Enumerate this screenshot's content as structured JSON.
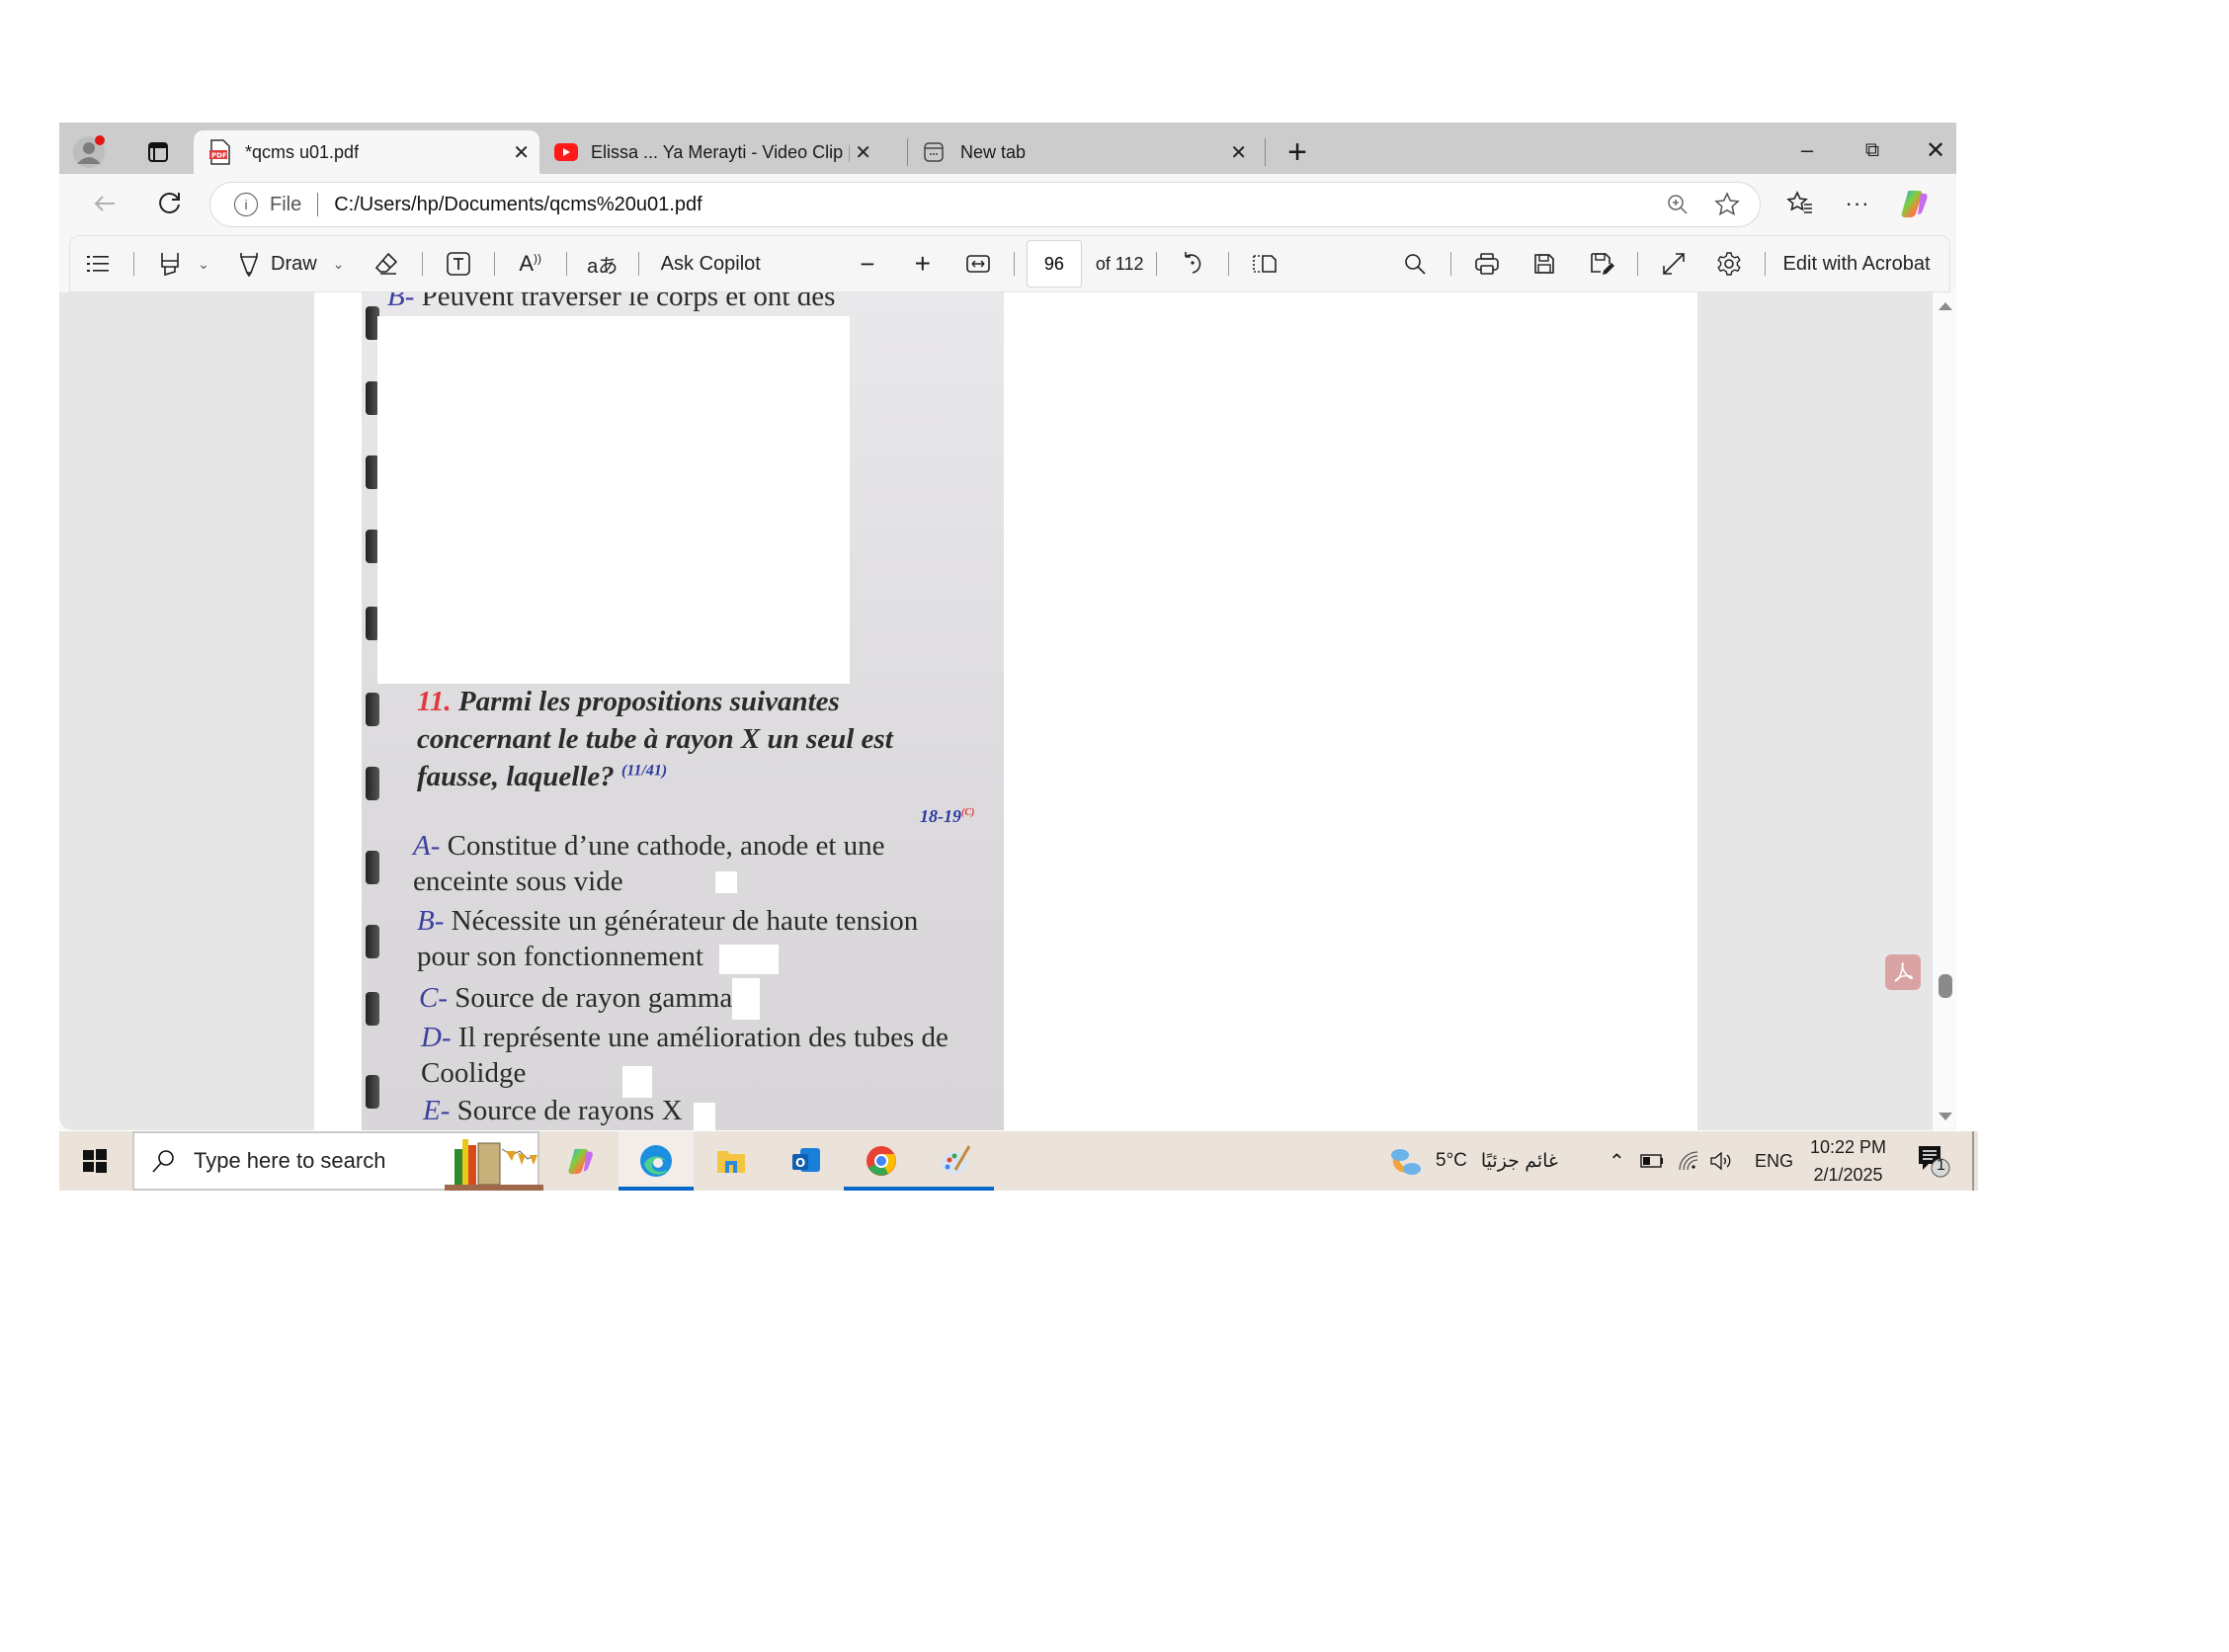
{
  "browser": {
    "tabs": [
      {
        "title": "*qcms u01.pdf",
        "icon": "pdf-icon",
        "active": true
      },
      {
        "title": "Elissa ... Ya Merayti - Video Clip | ",
        "icon": "youtube-icon",
        "active": false
      },
      {
        "title": "New tab",
        "icon": "new-tab-page-icon",
        "active": false
      }
    ],
    "new_tab_symbol": "+",
    "close_symbol": "✕",
    "window_controls": {
      "minimize": "–",
      "restore": "⧉",
      "close": "✕"
    },
    "address": {
      "scheme_label": "File",
      "url": "C:/Users/hp/Documents/qcms%20u01.pdf"
    }
  },
  "pdf_toolbar": {
    "draw_label": "Draw",
    "ask_copilot_label": "Ask Copilot",
    "page_current": "96",
    "page_total_label": "of 112",
    "edit_acrobat_label": "Edit with Acrobat"
  },
  "document": {
    "top_fragment": {
      "letter": "B-",
      "text": " Peuvent traverser le corps et ont des"
    },
    "question": {
      "number": "11.",
      "lines": [
        "Parmi les propositions suivantes",
        "concernant le tube à rayon X un seul est",
        "fausse, laquelle?"
      ],
      "reference": "(11/41)",
      "source_tag": "18-19",
      "source_sup": "(C)"
    },
    "options": [
      {
        "letter": "A-",
        "lines": [
          " Constitue d’une cathode, anode et une",
          "enceinte sous vide"
        ]
      },
      {
        "letter": "B-",
        "lines": [
          " Nécessite un générateur de haute tension",
          "pour son fonctionnement"
        ]
      },
      {
        "letter": "C-",
        "lines": [
          " Source de rayon gamma"
        ]
      },
      {
        "letter": "D-",
        "lines": [
          " Il représente une amélioration des tubes de",
          "Coolidge"
        ]
      },
      {
        "letter": "E-",
        "lines": [
          " Source de rayons X"
        ]
      }
    ],
    "colors": {
      "question_number": "#e0393e",
      "option_letter": "#3b3f9e",
      "reference": "#2a3aa0"
    }
  },
  "taskbar": {
    "search_placeholder": "Type here to search",
    "weather": {
      "temp": "5°C",
      "condition": "غائم جزئيًا"
    },
    "language": "ENG",
    "time": "10:22 PM",
    "date": "2/1/2025",
    "notification_count": "1",
    "pinned_apps": [
      "copilot-app",
      "edge-app",
      "file-explorer-app",
      "outlook-app",
      "chrome-app",
      "paint-app"
    ]
  }
}
